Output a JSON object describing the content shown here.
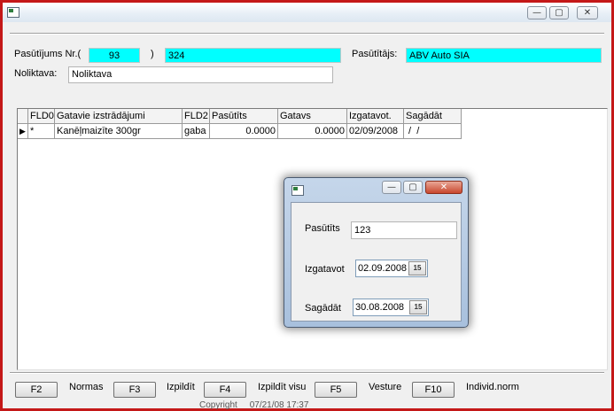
{
  "window": {
    "controls": {
      "minimize": "—",
      "maximize": "▢",
      "close": "✕"
    }
  },
  "header": {
    "order_label": "Pasūtījums Nr.(",
    "order_prefix": "93",
    "order_paren_close": ")",
    "order_number": "324",
    "customer_label": "Pasūtītājs:",
    "customer_value": "ABV Auto SIA",
    "warehouse_label": "Noliktava:",
    "warehouse_value": "Noliktava"
  },
  "grid": {
    "columns": [
      "FLD0",
      "Gatavie izstrādājumi",
      "FLD2",
      "Pasūtīts",
      "Gatavs",
      "Izgatavot.",
      "Sagādāt"
    ],
    "rows": [
      {
        "indicator": "▶",
        "cells": [
          "*",
          "Kanēļmaizīte 300gr",
          "gaba",
          "0.0000",
          "0.0000",
          "02/09/2008",
          " /  /"
        ]
      }
    ]
  },
  "dialog": {
    "controls": {
      "minimize": "—",
      "maximize": "▢",
      "close": "✕"
    },
    "ordered_label": "Pasūtīts",
    "ordered_value": "123",
    "produce_label": "Izgatavot",
    "produce_date": "02.09.2008",
    "procure_label": "Sagādāt",
    "procure_date": "30.08.2008",
    "calendar_glyph": "15"
  },
  "footer": {
    "buttons": [
      {
        "key": "F2",
        "label": "Normas"
      },
      {
        "key": "F3",
        "label": "Izpildīt"
      },
      {
        "key": "F4",
        "label": "Izpildīt visu"
      },
      {
        "key": "F5",
        "label": "Vesture"
      },
      {
        "key": "F10",
        "label": "Individ.norm"
      }
    ],
    "background_text": "Copyright     07/21/08 17:37"
  },
  "colors": {
    "frame": "#c41818",
    "highlight": "#00ffff",
    "dialog_close": "#c8472e"
  }
}
